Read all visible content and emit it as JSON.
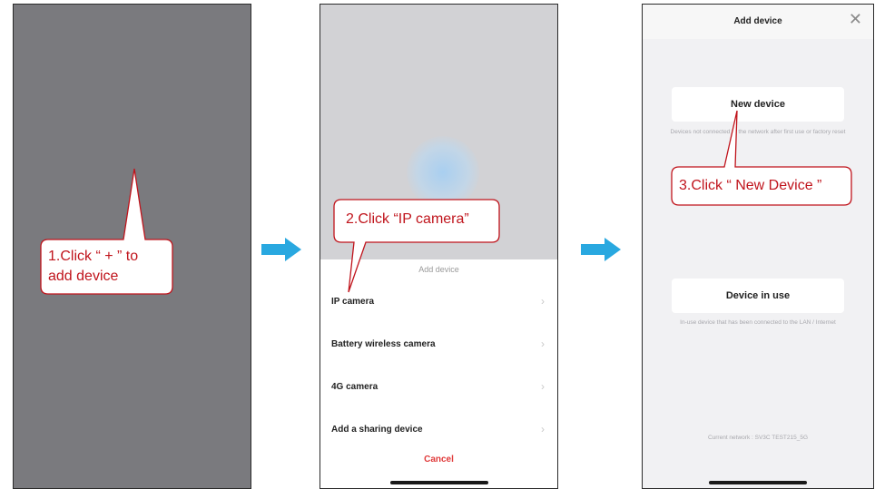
{
  "phone2": {
    "sheet_title": "Add device",
    "items": [
      {
        "label": "IP camera"
      },
      {
        "label": "Battery wireless camera"
      },
      {
        "label": "4G camera"
      },
      {
        "label": "Add a sharing device"
      }
    ],
    "chevron": "›",
    "cancel_label": "Cancel"
  },
  "phone3": {
    "title": "Add device",
    "close_icon": "✕",
    "new_device_label": "New device",
    "new_device_desc": "Devices not connected to the network after first use or factory reset",
    "in_use_label": "Device in use",
    "in_use_desc": "In-use device that has been connected to the LAN / Internet",
    "network_text": "Current network : SV3C TEST215_5G"
  },
  "callouts": {
    "step1_line1": "1.Click “ + ” to",
    "step1_line2": "add device",
    "step2": "2.Click “IP camera”",
    "step3": "3.Click “ New Device ”"
  },
  "colors": {
    "callout_red": "#c0141c",
    "arrow_blue": "#29a8e0",
    "cancel_red": "#e03a3a"
  }
}
